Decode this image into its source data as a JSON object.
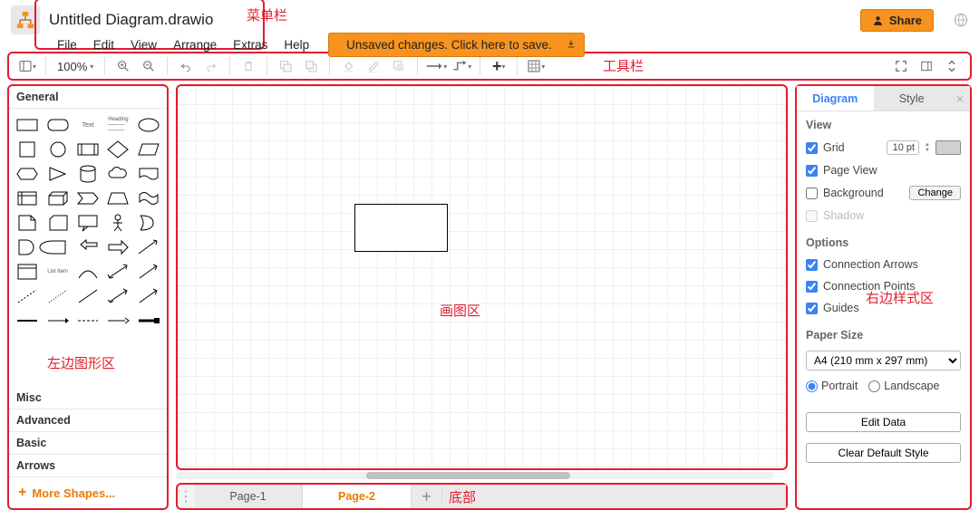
{
  "header": {
    "title": "Untitled Diagram.drawio",
    "share_label": "Share",
    "save_label": "Unsaved changes. Click here to save."
  },
  "menu": {
    "items": [
      "File",
      "Edit",
      "View",
      "Arrange",
      "Extras",
      "Help"
    ]
  },
  "toolbar": {
    "zoom": "100%"
  },
  "sidebar": {
    "categories": [
      "General",
      "Misc",
      "Advanced",
      "Basic",
      "Arrows"
    ],
    "more": "More Shapes..."
  },
  "tabs": {
    "items": [
      "Page-1",
      "Page-2"
    ],
    "active": 1
  },
  "rightPanel": {
    "tabs": [
      "Diagram",
      "Style"
    ],
    "active": 0,
    "view_title": "View",
    "grid_label": "Grid",
    "grid_value": "10 pt",
    "pageview_label": "Page View",
    "background_label": "Background",
    "change_label": "Change",
    "shadow_label": "Shadow",
    "options_title": "Options",
    "conn_arrows": "Connection Arrows",
    "conn_points": "Connection Points",
    "guides": "Guides",
    "papersize_title": "Paper Size",
    "paper_value": "A4 (210 mm x 297 mm)",
    "portrait": "Portrait",
    "landscape": "Landscape",
    "edit_data": "Edit Data",
    "clear_style": "Clear Default Style"
  },
  "overlays": {
    "menubar": "菜单栏",
    "toolbar": "工具栏",
    "leftshapes": "左边图形区",
    "canvas": "画图区",
    "rightstyle": "右边样式区",
    "bottom": "底部"
  }
}
